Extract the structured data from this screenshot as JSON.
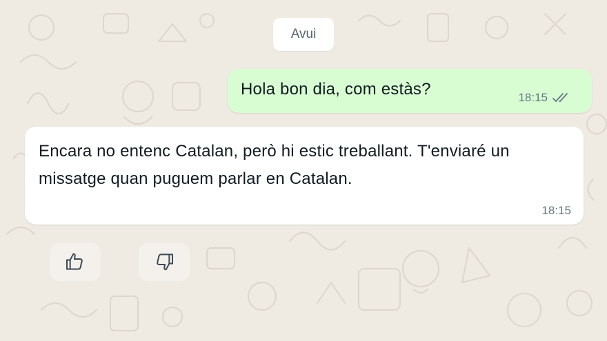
{
  "date_divider": {
    "label": "Avui"
  },
  "messages": [
    {
      "direction": "outgoing",
      "text": "Hola bon dia, com estàs?",
      "time": "18:15",
      "status_icon": "double-check-icon"
    },
    {
      "direction": "incoming",
      "text": "Encara no entenc Catalan, però hi estic treballant. T'enviaré un missatge quan puguem parlar en Catalan.",
      "time": "18:15"
    }
  ],
  "feedback": {
    "like_icon": "thumbs-up-icon",
    "dislike_icon": "thumbs-down-icon"
  },
  "colors": {
    "background": "#efeae2",
    "outgoing_bubble": "#d9fdd3",
    "incoming_bubble": "#ffffff",
    "timestamp": "#667781"
  }
}
